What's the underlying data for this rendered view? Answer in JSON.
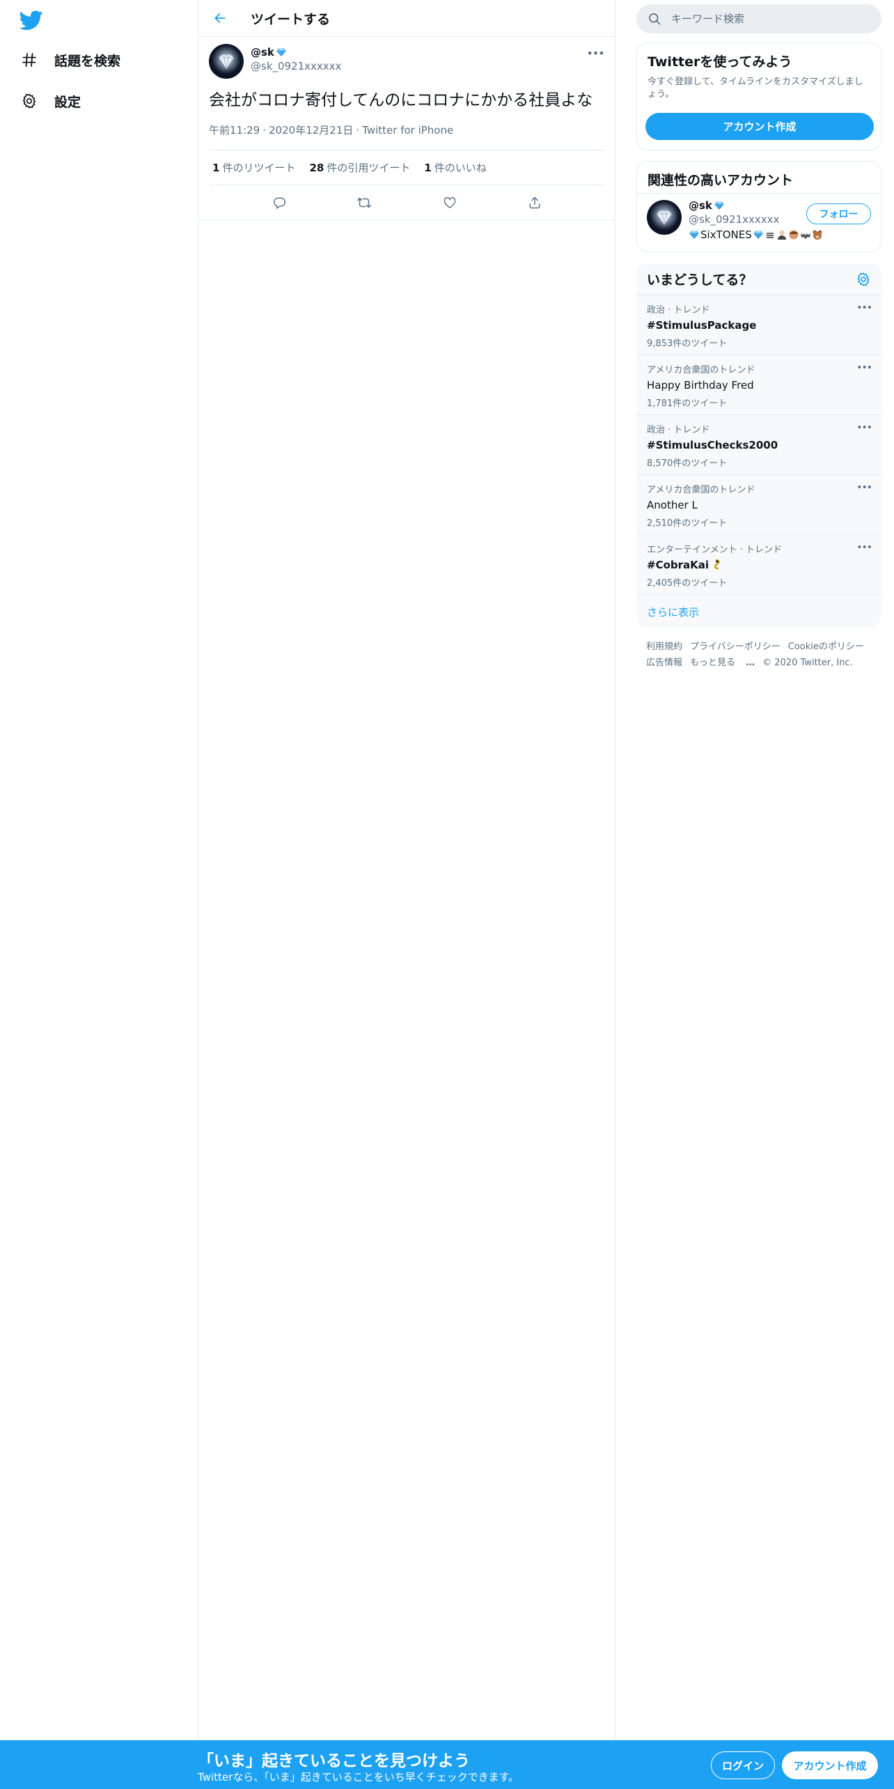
{
  "brand": {
    "accent": "#1da1f2",
    "text": "#0f1419",
    "secondary": "#5b7083",
    "border": "#e6ecf0"
  },
  "nav": {
    "logo_icon": "twitter-bird-icon",
    "items": [
      {
        "label": "話題を検索",
        "icon": "hashtag-icon"
      },
      {
        "label": "設定",
        "icon": "gear-icon"
      }
    ]
  },
  "header": {
    "back_icon": "arrow-left-icon",
    "title": "ツイートする"
  },
  "tweet": {
    "display_name": "@sk",
    "handle": "@sk_0921xxxxxx",
    "text": "会社がコロナ寄付してんのにコロナにかかる社員よな",
    "time": "午前11:29",
    "date": "2020年12月21日",
    "source": "Twitter for iPhone",
    "stats": [
      {
        "count": "1",
        "label": "件のリツイート"
      },
      {
        "count": "28",
        "label": "件の引用ツイート"
      },
      {
        "count": "1",
        "label": "件のいいね"
      }
    ],
    "actions": [
      "reply-icon",
      "retweet-icon",
      "like-icon",
      "share-icon"
    ]
  },
  "search": {
    "placeholder": "キーワード検索"
  },
  "signup_card": {
    "title": "Twitterを使ってみよう",
    "description": "今すぐ登録して、タイムラインをカスタマイズしましょう。",
    "button": "アカウント作成"
  },
  "related": {
    "title": "関連性の高いアカウント",
    "account": {
      "name": "@sk",
      "handle": "@sk_0921xxxxxx",
      "bio": "SixTONES",
      "follow_label": "フォロー"
    }
  },
  "trends": {
    "title": "いまどうしてる？",
    "items": [
      {
        "context": "政治 · トレンド",
        "name": "#StimulusPackage",
        "count": "9,853件のツイート"
      },
      {
        "context": "アメリカ合衆国のトレンド",
        "name": "Happy Birthday Fred",
        "count": "1,781件のツイート"
      },
      {
        "context": "政治 · トレンド",
        "name": "#StimulusChecks2000",
        "count": "8,570件のツイート"
      },
      {
        "context": "アメリカ合衆国のトレンド",
        "name": "Another L",
        "count": "2,510件のツイート"
      },
      {
        "context": "エンターテインメント · トレンド",
        "name": "#CobraKai",
        "count": "2,405件のツイート"
      }
    ],
    "show_more": "さらに表示"
  },
  "footer": {
    "links": [
      "利用規約",
      "プライバシーポリシー",
      "Cookieのポリシー",
      "広告情報",
      "もっと見る"
    ],
    "copyright": "© 2020 Twitter, Inc."
  },
  "banner": {
    "title": "「いま」起きていることを見つけよう",
    "subtitle": "Twitterなら、「いま」起きていることをいち早くチェックできます。",
    "login": "ログイン",
    "signup": "アカウント作成"
  }
}
